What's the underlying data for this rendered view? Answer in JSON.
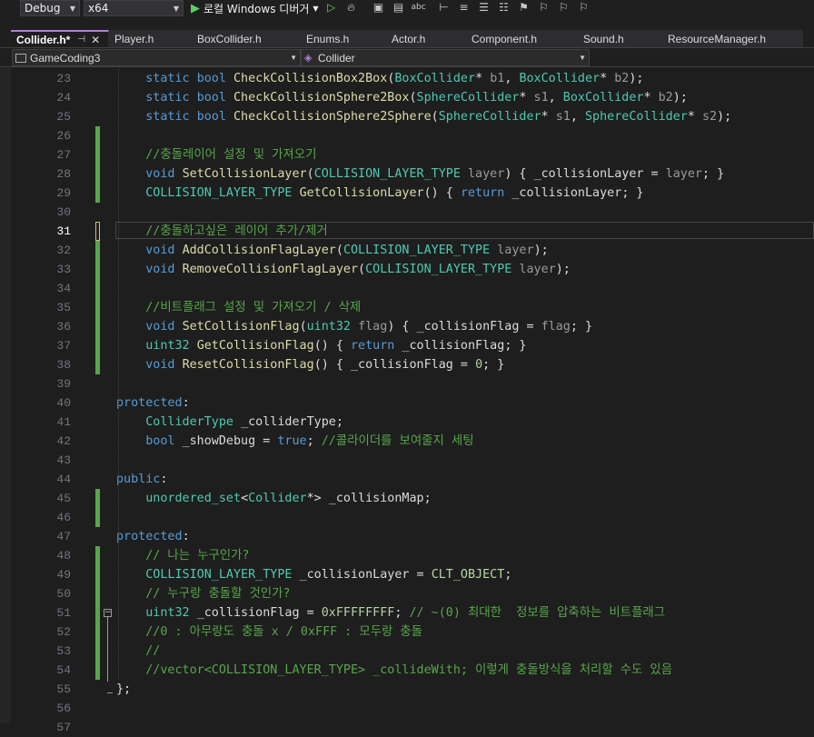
{
  "toolbar": {
    "config": "Debug",
    "platform": "x64",
    "run_label": "로컬 Windows 디버거",
    "icons": [
      "play-icon",
      "play-outline-icon",
      "hot-reload-icon",
      "solution-explorer-icon",
      "browse-icon",
      "spell-check-icon",
      "step-icon",
      "comment-icon",
      "bookmark-icon"
    ]
  },
  "tabs": [
    {
      "label": "Collider.h*",
      "active": true
    },
    {
      "label": "Player.h"
    },
    {
      "label": "BoxCollider.h"
    },
    {
      "label": "Enums.h"
    },
    {
      "label": "Actor.h"
    },
    {
      "label": "Component.h"
    },
    {
      "label": "Sound.h"
    },
    {
      "label": "ResourceManager.h"
    }
  ],
  "navbar": {
    "project": "GameCoding3",
    "scope": "Collider"
  },
  "colors": {
    "keyword": "#569cd6",
    "type": "#4ec9b0",
    "function": "#dcdcaa",
    "param": "#9a9a9a",
    "comment": "#57a64a",
    "change_saved": "#57a64a",
    "change_unsaved": "#d7ba7d"
  },
  "editor": {
    "current_line": 31,
    "lines": [
      {
        "n": 23,
        "chg": "",
        "tokens": [
          [
            "    ",
            ""
          ],
          [
            "static",
            "kw"
          ],
          [
            " ",
            ""
          ],
          [
            "bool",
            "kw"
          ],
          [
            " ",
            ""
          ],
          [
            "CheckCollisionBox2Box",
            "fn"
          ],
          [
            "(",
            ""
          ],
          [
            "BoxCollider",
            "ty"
          ],
          [
            "* ",
            ""
          ],
          [
            "b1",
            "pr"
          ],
          [
            ", ",
            ""
          ],
          [
            "BoxCollider",
            "ty"
          ],
          [
            "* ",
            ""
          ],
          [
            "b2",
            "pr"
          ],
          [
            ");",
            ""
          ]
        ]
      },
      {
        "n": 24,
        "chg": "",
        "tokens": [
          [
            "    ",
            ""
          ],
          [
            "static",
            "kw"
          ],
          [
            " ",
            ""
          ],
          [
            "bool",
            "kw"
          ],
          [
            " ",
            ""
          ],
          [
            "CheckCollisionSphere2Box",
            "fn"
          ],
          [
            "(",
            ""
          ],
          [
            "SphereCollider",
            "ty"
          ],
          [
            "* ",
            ""
          ],
          [
            "s1",
            "pr"
          ],
          [
            ", ",
            ""
          ],
          [
            "BoxCollider",
            "ty"
          ],
          [
            "* ",
            ""
          ],
          [
            "b2",
            "pr"
          ],
          [
            ");",
            ""
          ]
        ]
      },
      {
        "n": 25,
        "chg": "",
        "tokens": [
          [
            "    ",
            ""
          ],
          [
            "static",
            "kw"
          ],
          [
            " ",
            ""
          ],
          [
            "bool",
            "kw"
          ],
          [
            " ",
            ""
          ],
          [
            "CheckCollisionSphere2Sphere",
            "fn"
          ],
          [
            "(",
            ""
          ],
          [
            "SphereCollider",
            "ty"
          ],
          [
            "* ",
            ""
          ],
          [
            "s1",
            "pr"
          ],
          [
            ", ",
            ""
          ],
          [
            "SphereCollider",
            "ty"
          ],
          [
            "* ",
            ""
          ],
          [
            "s2",
            "pr"
          ],
          [
            ");",
            ""
          ]
        ]
      },
      {
        "n": 26,
        "chg": "green",
        "tokens": []
      },
      {
        "n": 27,
        "chg": "green",
        "tokens": [
          [
            "    ",
            ""
          ],
          [
            "//충돌레이어 설정 및 가져오기",
            "cm"
          ]
        ]
      },
      {
        "n": 28,
        "chg": "green",
        "tokens": [
          [
            "    ",
            ""
          ],
          [
            "void",
            "kw"
          ],
          [
            " ",
            ""
          ],
          [
            "SetCollisionLayer",
            "fn"
          ],
          [
            "(",
            ""
          ],
          [
            "COLLISION_LAYER_TYPE",
            "ty"
          ],
          [
            " ",
            ""
          ],
          [
            "layer",
            "pr"
          ],
          [
            ") { ",
            ""
          ],
          [
            "_collisionLayer",
            "mm"
          ],
          [
            " = ",
            ""
          ],
          [
            "layer",
            "pr"
          ],
          [
            "; }",
            ""
          ]
        ]
      },
      {
        "n": 29,
        "chg": "green",
        "tokens": [
          [
            "    ",
            ""
          ],
          [
            "COLLISION_LAYER_TYPE",
            "ty"
          ],
          [
            " ",
            ""
          ],
          [
            "GetCollisionLayer",
            "fn"
          ],
          [
            "() { ",
            ""
          ],
          [
            "return",
            "kw"
          ],
          [
            " ",
            ""
          ],
          [
            "_collisionLayer",
            "mm"
          ],
          [
            "; }",
            ""
          ]
        ]
      },
      {
        "n": 30,
        "chg": "",
        "tokens": []
      },
      {
        "n": 31,
        "chg": "yellow",
        "tokens": [
          [
            "    ",
            ""
          ],
          [
            "//충돌하고싶은 레이어 추가/제거",
            "cm"
          ]
        ]
      },
      {
        "n": 32,
        "chg": "green",
        "tokens": [
          [
            "    ",
            ""
          ],
          [
            "void",
            "kw"
          ],
          [
            " ",
            ""
          ],
          [
            "AddCollisionFlagLayer",
            "fn"
          ],
          [
            "(",
            ""
          ],
          [
            "COLLISION_LAYER_TYPE",
            "ty"
          ],
          [
            " ",
            ""
          ],
          [
            "layer",
            "pr"
          ],
          [
            ");",
            ""
          ]
        ]
      },
      {
        "n": 33,
        "chg": "green",
        "tokens": [
          [
            "    ",
            ""
          ],
          [
            "void",
            "kw"
          ],
          [
            " ",
            ""
          ],
          [
            "RemoveCollisionFlagLayer",
            "fn"
          ],
          [
            "(",
            ""
          ],
          [
            "COLLISION_LAYER_TYPE",
            "ty"
          ],
          [
            " ",
            ""
          ],
          [
            "layer",
            "pr"
          ],
          [
            ");",
            ""
          ]
        ]
      },
      {
        "n": 34,
        "chg": "green",
        "tokens": []
      },
      {
        "n": 35,
        "chg": "green",
        "tokens": [
          [
            "    ",
            ""
          ],
          [
            "//비트플래그 설정 및 가져오기 / 삭제",
            "cm"
          ]
        ]
      },
      {
        "n": 36,
        "chg": "green",
        "tokens": [
          [
            "    ",
            ""
          ],
          [
            "void",
            "kw"
          ],
          [
            " ",
            ""
          ],
          [
            "SetCollisionFlag",
            "fn"
          ],
          [
            "(",
            ""
          ],
          [
            "uint32",
            "ty"
          ],
          [
            " ",
            ""
          ],
          [
            "flag",
            "pr"
          ],
          [
            ") { ",
            ""
          ],
          [
            "_collisionFlag",
            "mm"
          ],
          [
            " = ",
            ""
          ],
          [
            "flag",
            "pr"
          ],
          [
            "; }",
            ""
          ]
        ]
      },
      {
        "n": 37,
        "chg": "green",
        "tokens": [
          [
            "    ",
            ""
          ],
          [
            "uint32",
            "ty"
          ],
          [
            " ",
            ""
          ],
          [
            "GetCollisionFlag",
            "fn"
          ],
          [
            "() { ",
            ""
          ],
          [
            "return",
            "kw"
          ],
          [
            " ",
            ""
          ],
          [
            "_collisionFlag",
            "mm"
          ],
          [
            "; }",
            ""
          ]
        ]
      },
      {
        "n": 38,
        "chg": "green",
        "tokens": [
          [
            "    ",
            ""
          ],
          [
            "void",
            "kw"
          ],
          [
            " ",
            ""
          ],
          [
            "ResetCollisionFlag",
            "fn"
          ],
          [
            "() { ",
            ""
          ],
          [
            "_collisionFlag",
            "mm"
          ],
          [
            " = ",
            ""
          ],
          [
            "0",
            "nm"
          ],
          [
            "; }",
            ""
          ]
        ]
      },
      {
        "n": 39,
        "chg": "",
        "tokens": []
      },
      {
        "n": 40,
        "chg": "",
        "tokens": [
          [
            "protected",
            "kw"
          ],
          [
            ":",
            ""
          ]
        ]
      },
      {
        "n": 41,
        "chg": "",
        "tokens": [
          [
            "    ",
            ""
          ],
          [
            "ColliderType",
            "ty"
          ],
          [
            " ",
            ""
          ],
          [
            "_colliderType",
            "mm"
          ],
          [
            ";",
            ""
          ]
        ]
      },
      {
        "n": 42,
        "chg": "",
        "tokens": [
          [
            "    ",
            ""
          ],
          [
            "bool",
            "kw"
          ],
          [
            " ",
            ""
          ],
          [
            "_showDebug",
            "mm"
          ],
          [
            " = ",
            ""
          ],
          [
            "true",
            "kw"
          ],
          [
            "; ",
            ""
          ],
          [
            "//콜라이더를 보여줄지 세팅",
            "cm"
          ]
        ]
      },
      {
        "n": 43,
        "chg": "",
        "tokens": []
      },
      {
        "n": 44,
        "chg": "",
        "tokens": [
          [
            "public",
            "kw"
          ],
          [
            ":",
            ""
          ]
        ]
      },
      {
        "n": 45,
        "chg": "green",
        "tokens": [
          [
            "    ",
            ""
          ],
          [
            "unordered_set",
            "ty"
          ],
          [
            "<",
            ""
          ],
          [
            "Collider",
            "ty"
          ],
          [
            "*> ",
            ""
          ],
          [
            "_collisionMap",
            "mm"
          ],
          [
            ";",
            ""
          ]
        ]
      },
      {
        "n": 46,
        "chg": "green",
        "tokens": []
      },
      {
        "n": 47,
        "chg": "",
        "tokens": [
          [
            "protected",
            "kw"
          ],
          [
            ":",
            ""
          ]
        ]
      },
      {
        "n": 48,
        "chg": "green",
        "tokens": [
          [
            "    ",
            ""
          ],
          [
            "// 나는 누구인가?",
            "cm"
          ]
        ]
      },
      {
        "n": 49,
        "chg": "green",
        "tokens": [
          [
            "    ",
            ""
          ],
          [
            "COLLISION_LAYER_TYPE",
            "ty"
          ],
          [
            " ",
            ""
          ],
          [
            "_collisionLayer",
            "mm"
          ],
          [
            " = ",
            ""
          ],
          [
            "CLT_OBJECT",
            "en"
          ],
          [
            ";",
            ""
          ]
        ]
      },
      {
        "n": 50,
        "chg": "green",
        "tokens": [
          [
            "    ",
            ""
          ],
          [
            "// 누구랑 충돌할 것인가?",
            "cm"
          ]
        ]
      },
      {
        "n": 51,
        "chg": "green",
        "tokens": [
          [
            "    ",
            ""
          ],
          [
            "uint32",
            "ty"
          ],
          [
            " ",
            ""
          ],
          [
            "_collisionFlag",
            "mm"
          ],
          [
            " = ",
            ""
          ],
          [
            "0xFFFFFFFF",
            "nm"
          ],
          [
            "; ",
            ""
          ],
          [
            "// ~(0) 최대한  정보를 압축하는 비트플래그",
            "cm"
          ]
        ]
      },
      {
        "n": 52,
        "chg": "green",
        "tokens": [
          [
            "    ",
            ""
          ],
          [
            "//0 : 아무랑도 충돌 x / 0xFFF : 모두랑 충돌",
            "cm"
          ]
        ]
      },
      {
        "n": 53,
        "chg": "green",
        "tokens": [
          [
            "    ",
            ""
          ],
          [
            "//",
            "cm"
          ]
        ]
      },
      {
        "n": 54,
        "chg": "green",
        "tokens": [
          [
            "    ",
            ""
          ],
          [
            "//vector<COLLISION_LAYER_TYPE> _collideWith; 이렇게 충돌방식을 처리할 수도 있음",
            "cm"
          ]
        ]
      },
      {
        "n": 55,
        "chg": "",
        "tokens": [
          [
            "};",
            ""
          ]
        ]
      },
      {
        "n": 56,
        "chg": "",
        "tokens": []
      },
      {
        "n": 57,
        "chg": "",
        "tokens": []
      }
    ]
  }
}
